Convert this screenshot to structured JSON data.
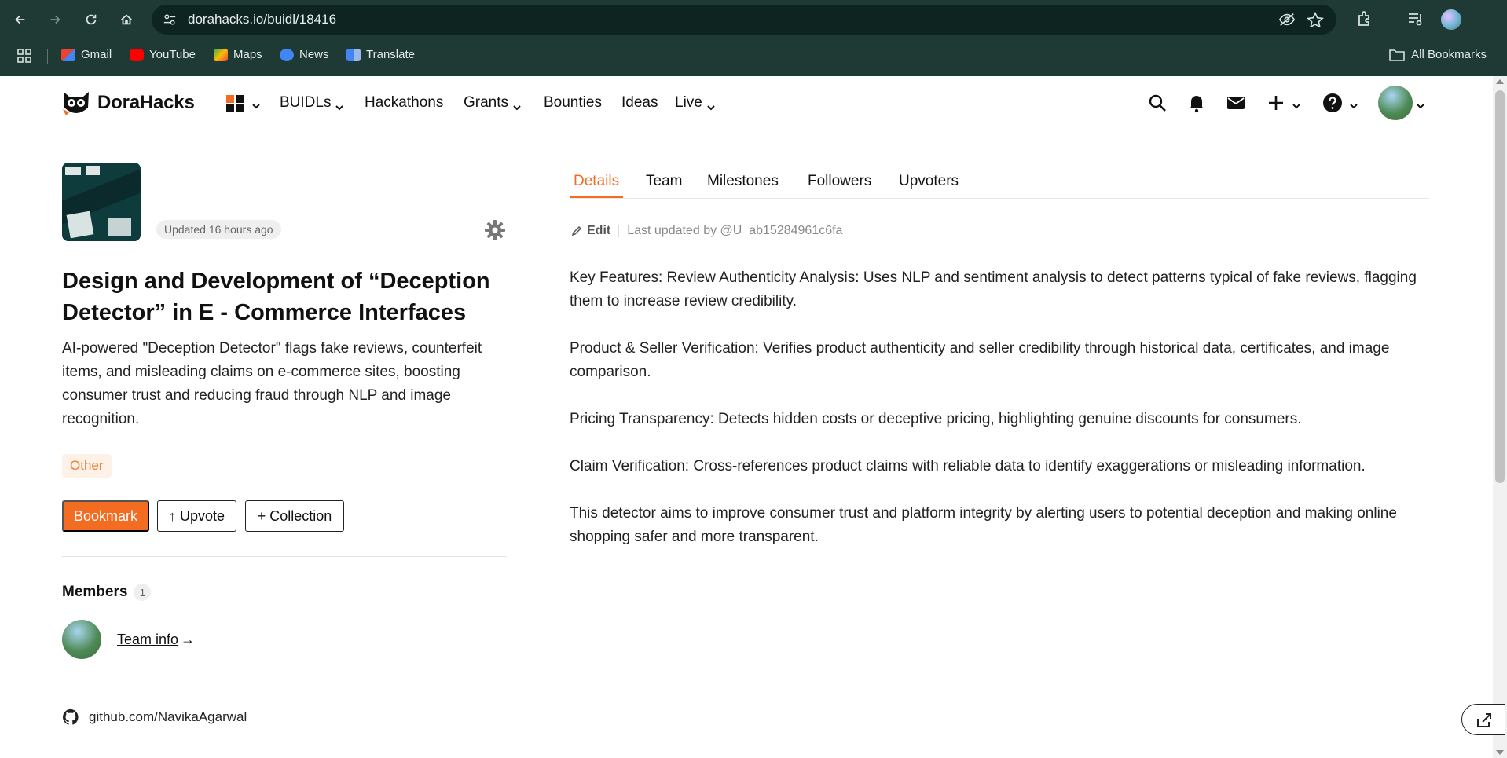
{
  "browser": {
    "url": "dorahacks.io/buidl/18416",
    "bookmarks": [
      {
        "label": "Gmail",
        "color": "#ea4335"
      },
      {
        "label": "YouTube",
        "color": "#ff0000"
      },
      {
        "label": "Maps",
        "color": "#34a853"
      },
      {
        "label": "News",
        "color": "#4285f4"
      },
      {
        "label": "Translate",
        "color": "#4285f4"
      }
    ],
    "all_bookmarks": "All Bookmarks"
  },
  "header": {
    "logo_text": "DoraHacks",
    "nav": [
      {
        "label": "BUIDLs",
        "dropdown": true
      },
      {
        "label": "Hackathons",
        "dropdown": false
      },
      {
        "label": "Grants",
        "dropdown": true
      },
      {
        "label": "Bounties",
        "dropdown": false
      },
      {
        "label": "Ideas",
        "dropdown": false
      },
      {
        "label": "Live",
        "dropdown": true
      }
    ]
  },
  "project": {
    "updated": "Updated 16 hours ago",
    "title": "Design and Development of “Deception Detector” in E - Commerce Interfaces",
    "description": "AI-powered \"Deception Detector\" flags fake reviews, counterfeit items, and misleading claims on e-commerce sites, boosting consumer trust and reducing fraud through NLP and image recognition.",
    "tag": "Other",
    "buttons": {
      "bookmark": "Bookmark",
      "upvote": "↑ Upvote",
      "collection": "+ Collection"
    },
    "members_label": "Members",
    "members_count": "1",
    "team_info": "Team info",
    "team_arrow": "→",
    "github": "github.com/NavikaAgarwal"
  },
  "tabs": [
    "Details",
    "Team",
    "Milestones",
    "Followers",
    "Upvoters"
  ],
  "details": {
    "edit": "Edit",
    "last_updated": "Last updated by @U_ab15284961c6fa",
    "paragraphs": [
      "Key Features: Review Authenticity Analysis: Uses NLP and sentiment analysis to detect patterns typical of fake reviews, flagging them to increase review credibility.",
      "Product & Seller Verification: Verifies product authenticity and seller credibility through historical data, certificates, and image comparison.",
      "Pricing Transparency: Detects hidden costs or deceptive pricing, highlighting genuine discounts for consumers.",
      "Claim Verification: Cross-references product claims with reliable data to identify exaggerations or misleading information.",
      "This detector aims to improve consumer trust and platform integrity by alerting users to potential deception and making online shopping safer and more transparent."
    ]
  },
  "colors": {
    "accent": "#f26c21",
    "chrome": "#1f3a35"
  }
}
